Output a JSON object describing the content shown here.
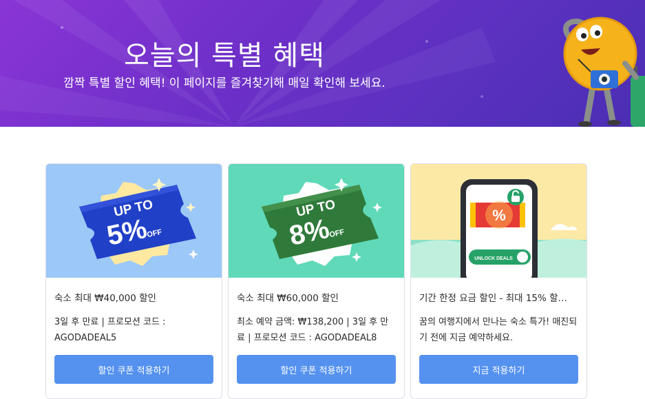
{
  "banner": {
    "title": "오늘의 특별 혜택",
    "subtitle": "깜짝 특별 할인 혜택! 이 페이지를 즐겨찾기해 매일 확인해 보세요."
  },
  "cards": [
    {
      "badge_line1": "UP TO",
      "badge_value": "5%",
      "badge_off": "OFF",
      "heading": "숙소 최대 ₩40,000 할인",
      "details": "3일 후 만료 | 프로모션 코드 : AGODADEAL5",
      "button": "할인 쿠폰 적용하기",
      "art_bg": "#9cc8f7",
      "ticket_color": "#2140c8"
    },
    {
      "badge_line1": "UP TO",
      "badge_value": "8%",
      "badge_off": "OFF",
      "heading": "숙소 최대 ₩60,000 할인",
      "details": "최소 예약 금액: ₩138,200 | 3일 후 만료 | 프로모션 코드 : AGODADEAL8",
      "button": "할인 쿠폰 적용하기",
      "art_bg": "#5fd9b8",
      "ticket_color": "#2f7a3a"
    },
    {
      "phone_symbol": "%",
      "phone_button": "UNLOCK DEALS",
      "heading": "기간 한정 요금 할인 - 최대 15% 할…",
      "details": "꿈의 여행지에서 만나는 숙소 특가! 매진되기 전에 지금 예약하세요.",
      "button": "지금 적용하기",
      "art_bg": "#fde9a6"
    }
  ],
  "colors": {
    "button": "#5592ef",
    "banner_start": "#8a35d6",
    "banner_end": "#4a2eb3"
  }
}
